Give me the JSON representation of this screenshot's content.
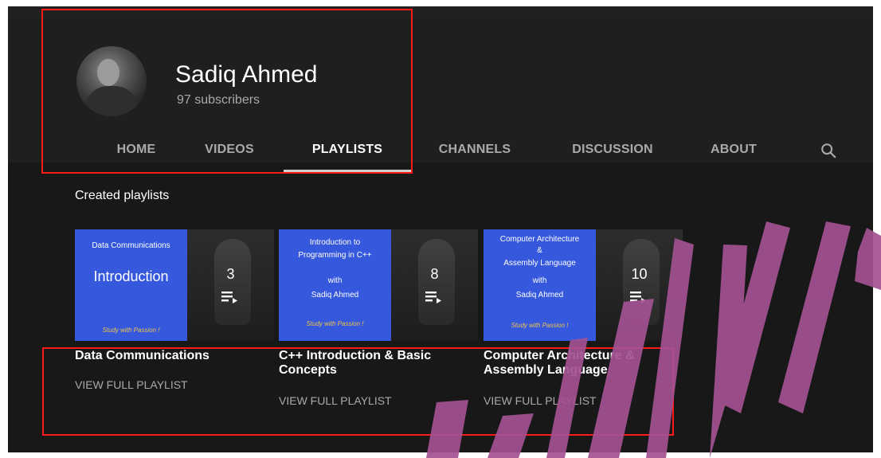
{
  "channel": {
    "name": "Sadiq Ahmed",
    "subscribers": "97 subscribers"
  },
  "tabs": [
    {
      "label": "HOME"
    },
    {
      "label": "VIDEOS"
    },
    {
      "label": "PLAYLISTS"
    },
    {
      "label": "CHANNELS"
    },
    {
      "label": "DISCUSSION"
    },
    {
      "label": "ABOUT"
    }
  ],
  "section": {
    "title": "Created playlists"
  },
  "playlists": [
    {
      "cover_line1": "Data Communications",
      "cover_line2": "Introduction",
      "cover_line3": "Study with Passion !",
      "count": "3",
      "title": "Data Communications",
      "link": "VIEW FULL PLAYLIST"
    },
    {
      "cover_line1": "Introduction to",
      "cover_line2": "Programming in C++",
      "cover_line3": "with",
      "cover_line4": "Sadiq Ahmed",
      "cover_line5": "Study with Passion !",
      "count": "8",
      "title_line1": "C++ Introduction & Basic",
      "title_line2": "Concepts",
      "link": "VIEW FULL PLAYLIST"
    },
    {
      "cover_line1": "Computer Architecture",
      "cover_line2": "&",
      "cover_line3": "Assembly Language",
      "cover_line4": "with",
      "cover_line5": "Sadiq Ahmed",
      "cover_line6": "Study with Passion !",
      "count": "10",
      "title_line1": "Computer Architecture &",
      "title_line2": "Assembly Language",
      "link": "VIEW FULL PLAYLIST"
    }
  ],
  "colors": {
    "background": "#181818",
    "header": "#1f1f1f",
    "cover_blue": "#3558dd",
    "text_primary": "#ffffff",
    "text_secondary": "#aaaaaa",
    "annotation_red": "#ff1a1a",
    "watermark_magenta": "#a35293"
  },
  "icons": {
    "search": "search-icon",
    "playlist": "playlist-icon"
  }
}
